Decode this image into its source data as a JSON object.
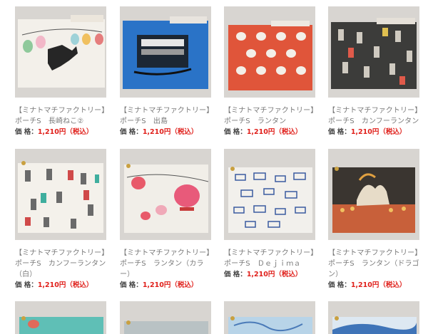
{
  "products": [
    {
      "brand": "【ミナトマチファクトリー】",
      "name": "ポーチS　長崎ねこ②",
      "price_label": "価 格：",
      "price": "1,210円",
      "tax": "（税込）",
      "image_icon": "cat-lanterns-pouch"
    },
    {
      "brand": "【ミナトマチファクトリー】",
      "name": "ポーチS　出島",
      "price_label": "価 格：",
      "price": "1,210円",
      "tax": "（税込）",
      "image_icon": "dejima-ship-pouch"
    },
    {
      "brand": "【ミナトマチファクトリー】",
      "name": "ポーチS　ランタン",
      "price_label": "価 格：",
      "price": "1,210円",
      "tax": "（税込）",
      "image_icon": "lantern-pattern-pouch"
    },
    {
      "brand": "【ミナトマチファクトリー】",
      "name": "ポーチS　カンフーランタン",
      "price_label": "価 格：",
      "price": "1,210円",
      "tax": "（税込）",
      "image_icon": "kungfu-pattern-pouch"
    },
    {
      "brand": "【ミナトマチファクトリー】",
      "name": "ポーチS　カンフーランタン（白）",
      "price_label": "価 格：",
      "price": "1,210円",
      "tax": "（税込）",
      "image_icon": "kungfu-white-pouch"
    },
    {
      "brand": "【ミナトマチファクトリー】",
      "name": "ポーチS　ランタン（カラー）",
      "price_label": "価 格：",
      "price": "1,210円",
      "tax": "（税込）",
      "image_icon": "lantern-color-pouch"
    },
    {
      "brand": "【ミナトマチファクトリー】",
      "name": "ポーチS　Ｄｅｊｉｍａ",
      "price_label": "価 格：",
      "price": "1,210円",
      "tax": "（税込）",
      "image_icon": "dejima-pattern-pouch"
    },
    {
      "brand": "【ミナトマチファクトリー】",
      "name": "ポーチS　ランタン（ドラゴン）",
      "price_label": "価 格：",
      "price": "1,210円",
      "tax": "（税込）",
      "image_icon": "dragon-lantern-pouch"
    },
    {
      "image_icon": "teal-pouch"
    },
    {
      "image_icon": "grey-pouch"
    },
    {
      "image_icon": "blue-pattern-pouch"
    },
    {
      "image_icon": "blue-wave-pouch"
    }
  ],
  "colors": {
    "price": "#e0201b",
    "text": "#7a7a7a",
    "photo_bg": "#d9d6d3"
  }
}
